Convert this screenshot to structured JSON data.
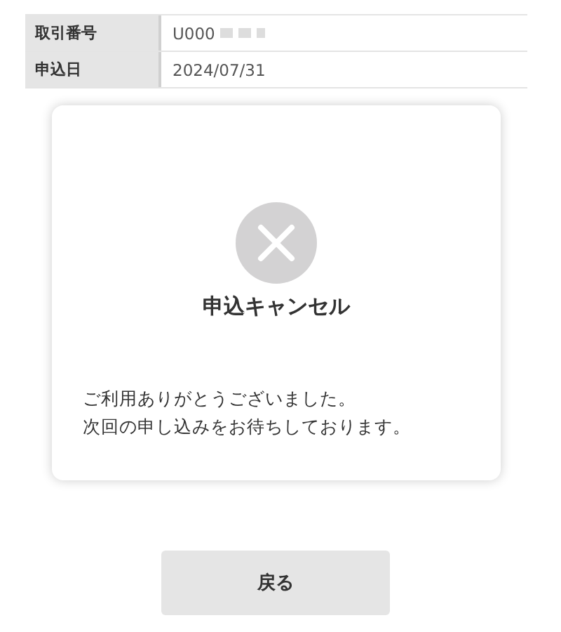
{
  "details": [
    {
      "label": "取引番号",
      "value": "U000"
    },
    {
      "label": "申込日",
      "value": "2024/07/31"
    }
  ],
  "result": {
    "title": "申込キャンセル",
    "message_lines": [
      "ご利用ありがとうございました。",
      "次回の申し込みをお待ちしております。"
    ]
  },
  "back_button": {
    "label": "戻る"
  }
}
